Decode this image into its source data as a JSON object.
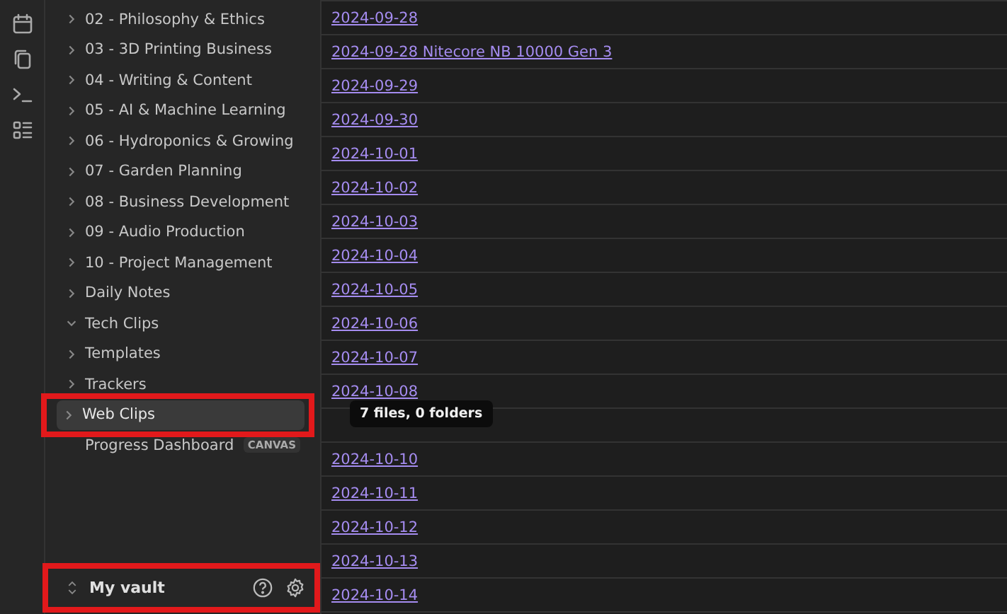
{
  "sidebar": {
    "items": [
      {
        "label": "02 - Philosophy & Ethics",
        "kind": "folder",
        "expanded": false,
        "selected": false,
        "highlighted": false
      },
      {
        "label": "03 - 3D Printing Business",
        "kind": "folder",
        "expanded": false,
        "selected": false,
        "highlighted": false
      },
      {
        "label": "04 - Writing & Content",
        "kind": "folder",
        "expanded": false,
        "selected": false,
        "highlighted": false
      },
      {
        "label": "05 - AI & Machine Learning",
        "kind": "folder",
        "expanded": false,
        "selected": false,
        "highlighted": false
      },
      {
        "label": "06 - Hydroponics & Growing",
        "kind": "folder",
        "expanded": false,
        "selected": false,
        "highlighted": false
      },
      {
        "label": "07 - Garden Planning",
        "kind": "folder",
        "expanded": false,
        "selected": false,
        "highlighted": false
      },
      {
        "label": "08 - Business Development",
        "kind": "folder",
        "expanded": false,
        "selected": false,
        "highlighted": false
      },
      {
        "label": "09 - Audio Production",
        "kind": "folder",
        "expanded": false,
        "selected": false,
        "highlighted": false
      },
      {
        "label": "10 - Project Management",
        "kind": "folder",
        "expanded": false,
        "selected": false,
        "highlighted": false
      },
      {
        "label": "Daily Notes",
        "kind": "folder",
        "expanded": false,
        "selected": false,
        "highlighted": false
      },
      {
        "label": "Tech Clips",
        "kind": "folder",
        "expanded": true,
        "selected": false,
        "highlighted": false
      },
      {
        "label": "Templates",
        "kind": "folder",
        "expanded": false,
        "selected": false,
        "highlighted": false
      },
      {
        "label": "Trackers",
        "kind": "folder",
        "expanded": false,
        "selected": false,
        "highlighted": false
      },
      {
        "label": "Web Clips",
        "kind": "folder",
        "expanded": false,
        "selected": true,
        "highlighted": true
      },
      {
        "label": "Progress Dashboard",
        "kind": "file",
        "badge": "CANVAS",
        "selected": false,
        "highlighted": false
      }
    ],
    "vault": {
      "name": "My vault",
      "highlighted": true
    }
  },
  "table": {
    "rows": [
      {
        "kind": "link",
        "text": "2024-09-28"
      },
      {
        "kind": "link",
        "text": "2024-09-28 Nitecore NB 10000 Gen 3"
      },
      {
        "kind": "link",
        "text": "2024-09-29"
      },
      {
        "kind": "link",
        "text": "2024-09-30"
      },
      {
        "kind": "link",
        "text": "2024-10-01"
      },
      {
        "kind": "link",
        "text": "2024-10-02"
      },
      {
        "kind": "link",
        "text": "2024-10-03"
      },
      {
        "kind": "link",
        "text": "2024-10-04"
      },
      {
        "kind": "link",
        "text": "2024-10-05"
      },
      {
        "kind": "link",
        "text": "2024-10-06"
      },
      {
        "kind": "link",
        "text": "2024-10-07"
      },
      {
        "kind": "link",
        "text": "2024-10-08"
      },
      {
        "kind": "covered",
        "tooltip": "7 files, 0 folders"
      },
      {
        "kind": "link",
        "text": "2024-10-10"
      },
      {
        "kind": "link",
        "text": "2024-10-11"
      },
      {
        "kind": "link",
        "text": "2024-10-12"
      },
      {
        "kind": "link",
        "text": "2024-10-13"
      },
      {
        "kind": "link",
        "text": "2024-10-14"
      }
    ]
  }
}
